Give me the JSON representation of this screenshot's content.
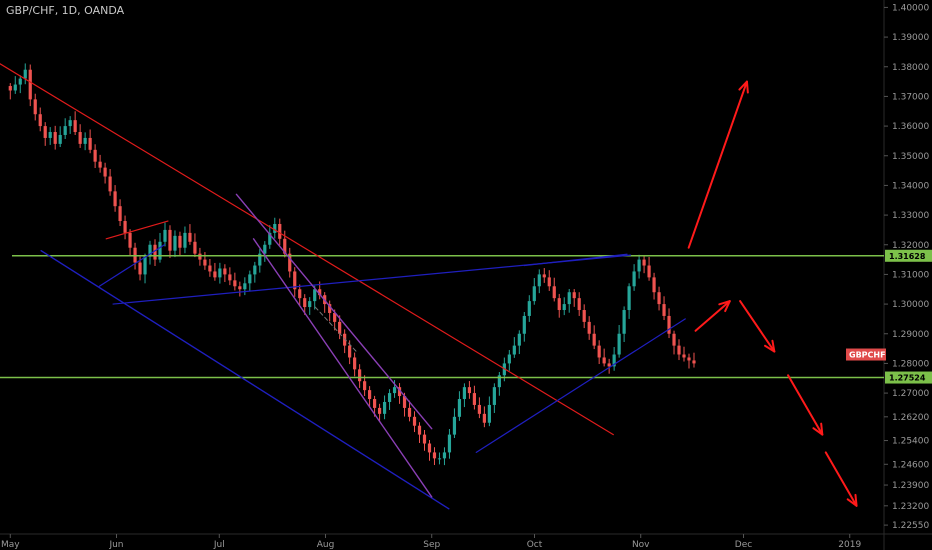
{
  "header": {
    "title": "GBP/CHF, 1D, OANDA"
  },
  "colors": {
    "background": "#000000",
    "up": "#26a69a",
    "down": "#ef5350",
    "axis_text": "#9a9a9a",
    "horizontal_level": "#7cc04a",
    "trend_red": "#e01b1b",
    "trend_blue": "#1f1fbf",
    "channel_purple": "#8a3fb5",
    "arrow": "#ff1a1a",
    "symbol_badge": "#e04a4a"
  },
  "chart_data": {
    "type": "candlestick",
    "title": "GBP/CHF, 1D, OANDA",
    "ylim": [
      1.2225,
      1.4025
    ],
    "y_ticks": [
      "1.40000",
      "1.39000",
      "1.38000",
      "1.37000",
      "1.36000",
      "1.35000",
      "1.34000",
      "1.33000",
      "1.32000",
      "1.31000",
      "1.30000",
      "1.29000",
      "1.28000",
      "1.27000",
      "1.26200",
      "1.25400",
      "1.24600",
      "1.23900",
      "1.23200",
      "1.22550"
    ],
    "x_ticks": [
      {
        "label": "May",
        "day": 0
      },
      {
        "label": "Jun",
        "day": 31
      },
      {
        "label": "Jul",
        "day": 61
      },
      {
        "label": "Aug",
        "day": 92
      },
      {
        "label": "Sep",
        "day": 123
      },
      {
        "label": "Oct",
        "day": 153
      },
      {
        "label": "Nov",
        "day": 184
      },
      {
        "label": "Dec",
        "day": 214
      },
      {
        "label": "2019",
        "day": 245
      }
    ],
    "x_range_days": [
      -3,
      255
    ],
    "closes": [
      1.372,
      1.374,
      1.376,
      1.379,
      1.369,
      1.364,
      1.36,
      1.356,
      1.358,
      1.354,
      1.357,
      1.36,
      1.362,
      1.358,
      1.354,
      1.356,
      1.352,
      1.348,
      1.346,
      1.343,
      1.338,
      1.333,
      1.328,
      1.324,
      1.319,
      1.314,
      1.31,
      1.316,
      1.32,
      1.315,
      1.321,
      1.325,
      1.318,
      1.323,
      1.319,
      1.324,
      1.321,
      1.317,
      1.315,
      1.313,
      1.311,
      1.309,
      1.312,
      1.31,
      1.308,
      1.306,
      1.305,
      1.307,
      1.31,
      1.313,
      1.317,
      1.32,
      1.324,
      1.327,
      1.322,
      1.317,
      1.311,
      1.305,
      1.302,
      1.299,
      1.301,
      1.305,
      1.303,
      1.3,
      1.297,
      1.294,
      1.29,
      1.286,
      1.282,
      1.278,
      1.274,
      1.271,
      1.268,
      1.265,
      1.263,
      1.267,
      1.27,
      1.272,
      1.269,
      1.265,
      1.262,
      1.259,
      1.256,
      1.253,
      1.25,
      1.248,
      1.248,
      1.25,
      1.256,
      1.262,
      1.268,
      1.272,
      1.27,
      1.266,
      1.263,
      1.26,
      1.266,
      1.272,
      1.276,
      1.28,
      1.283,
      1.286,
      1.29,
      1.296,
      1.301,
      1.306,
      1.31,
      1.309,
      1.306,
      1.302,
      1.298,
      1.3,
      1.304,
      1.302,
      1.298,
      1.294,
      1.29,
      1.286,
      1.282,
      1.28,
      1.279,
      1.283,
      1.29,
      1.298,
      1.306,
      1.311,
      1.315,
      1.313,
      1.309,
      1.304,
      1.3,
      1.296,
      1.29,
      1.286,
      1.283,
      1.282,
      1.281,
      1.28
    ],
    "levels": [
      {
        "value": 1.31628,
        "label": "1.31628"
      },
      {
        "value": 1.27524,
        "label": "1.27524"
      }
    ],
    "last_price": {
      "value": 1.283,
      "label": "GBPCHF"
    }
  }
}
